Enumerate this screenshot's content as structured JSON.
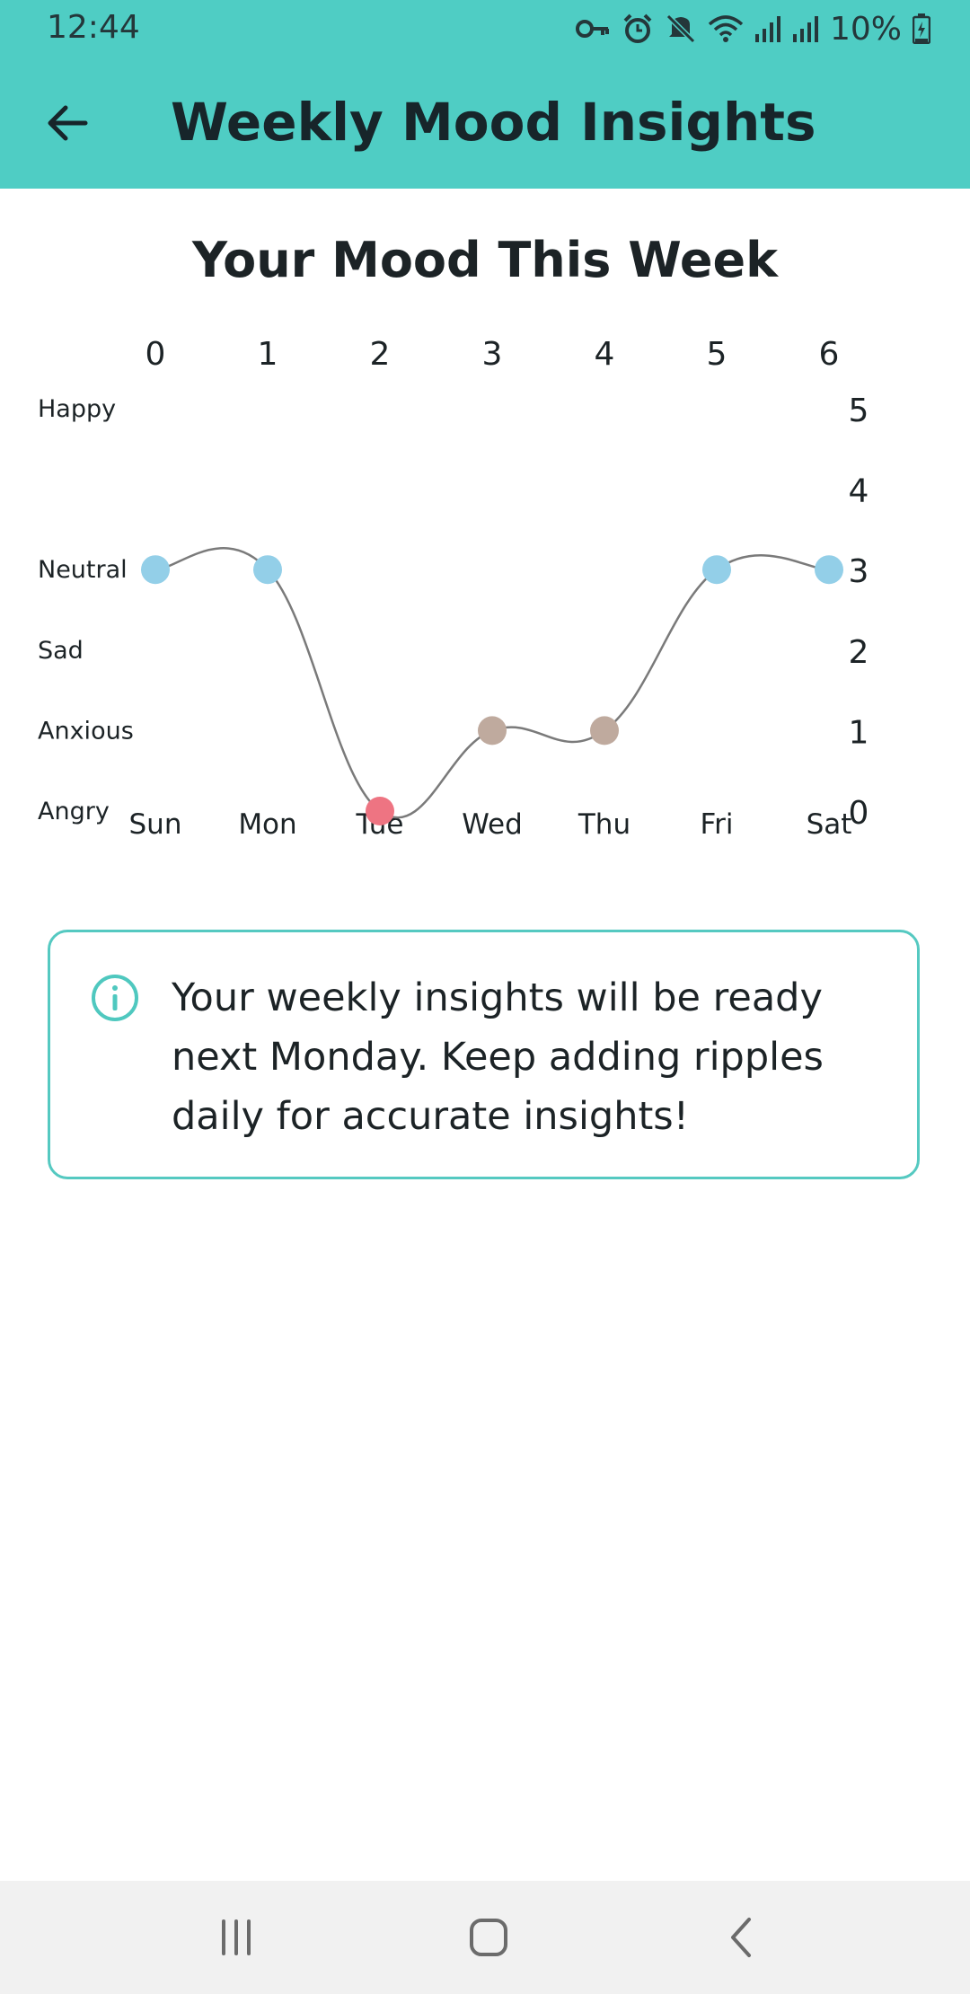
{
  "status_bar": {
    "time": "12:44",
    "battery": "10%",
    "icons": [
      "vpn-key-icon",
      "alarm-icon",
      "mute-icon",
      "wifi-icon",
      "signal-icon",
      "signal-icon",
      "battery-charging-icon"
    ]
  },
  "app_bar": {
    "title": "Weekly Mood Insights",
    "back_icon": "arrow-left-icon",
    "background": "#4fcdc4"
  },
  "chart_data": {
    "type": "line",
    "title": "Your Mood This Week",
    "x": [
      0,
      1,
      2,
      3,
      4,
      5,
      6
    ],
    "top_tick_labels": [
      "0",
      "1",
      "2",
      "3",
      "4",
      "5",
      "6"
    ],
    "categories": [
      "Sun",
      "Mon",
      "Tue",
      "Wed",
      "Thu",
      "Fri",
      "Sat"
    ],
    "y_right_ticks": [
      "0",
      "1",
      "2",
      "3",
      "4",
      "5"
    ],
    "y_left_labels": [
      {
        "value": 5,
        "label": "Happy"
      },
      {
        "value": 3,
        "label": "Neutral"
      },
      {
        "value": 2,
        "label": "Sad"
      },
      {
        "value": 1,
        "label": "Anxious"
      },
      {
        "value": 0,
        "label": "Angry"
      }
    ],
    "ylim": [
      0,
      5
    ],
    "values": [
      3,
      3,
      0,
      1,
      1,
      3,
      3
    ],
    "point_colors": [
      "#93cfe8",
      "#93cfe8",
      "#ee7482",
      "#bfaa9e",
      "#bfaa9e",
      "#93cfe8",
      "#93cfe8"
    ],
    "line_color": "#7a7a7a",
    "smooth": true,
    "grid": false
  },
  "info_card": {
    "icon": "info-icon",
    "text": "Your weekly insights will be ready next Monday. Keep adding ripples daily for accurate insights!",
    "border_color": "#55c9c1"
  },
  "nav_bar": {
    "recents_icon": "recents-icon",
    "home_icon": "home-icon",
    "back_icon": "back-chevron-icon"
  }
}
